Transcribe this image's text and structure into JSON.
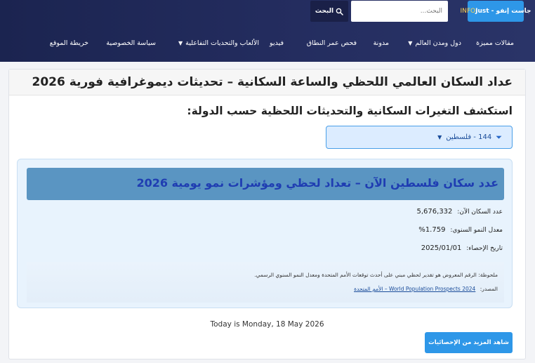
{
  "header": {
    "logo": {
      "text": "جاست إنفو - Just",
      "accent": "INFO"
    },
    "search": {
      "placeholder": "البحث...",
      "button_label": "البحث"
    },
    "nav": [
      {
        "label": "مقالات مميزة"
      },
      {
        "label": "دول ومدن العالم"
      },
      {
        "label": "مدونة"
      },
      {
        "label": "فحص عمر النطاق"
      },
      {
        "label": "فيديو"
      },
      {
        "label": "الألعاب والتحديات التفاعلية"
      },
      {
        "label": "سياسة الخصوصية"
      },
      {
        "label": "خريطة الموقع"
      }
    ]
  },
  "main": {
    "title": "عداد السكان العالمي اللحظي والساعة السكانية – تحديثات ديموغرافية فورية 2026",
    "subheading": "استكشف التغيرات السكانية والتحديثات اللحظية حسب الدولة:",
    "country_select": {
      "value": "144 - فلسطين"
    },
    "card": {
      "title": "عدد سكان فلسطين الآن – تعداد لحظي ومؤشرات نمو يومية 2026",
      "stats": [
        {
          "label": "عدد السكان الآن:",
          "value": "5,676,332"
        },
        {
          "label": "معدل النمو السنوي:",
          "value": "1.759%"
        },
        {
          "label": "تاريخ الإحصاء:",
          "value": "2025/01/01"
        }
      ],
      "note": "ملحوظة: الرقم المعروض هو تقدير لحظي مبني على أحدث توقعات الأمم المتحدة ومعدل النمو السنوي الرسمي.",
      "source_label": "المصدر:",
      "source_link": "World Population Prospects 2024 – الأمم المتحدة"
    },
    "today": "Today is Monday, 18 May 2026",
    "more_button": "شاهد المزيد من الإحصائيات"
  },
  "colors": {
    "header_bg": "#1b2450",
    "accent_blue": "#2e97e8",
    "logo_accent": "#ffd34d",
    "card_title_bg": "#5a95c2",
    "card_title_text": "#1f3db2",
    "card_bg": "#e8f3fd"
  }
}
